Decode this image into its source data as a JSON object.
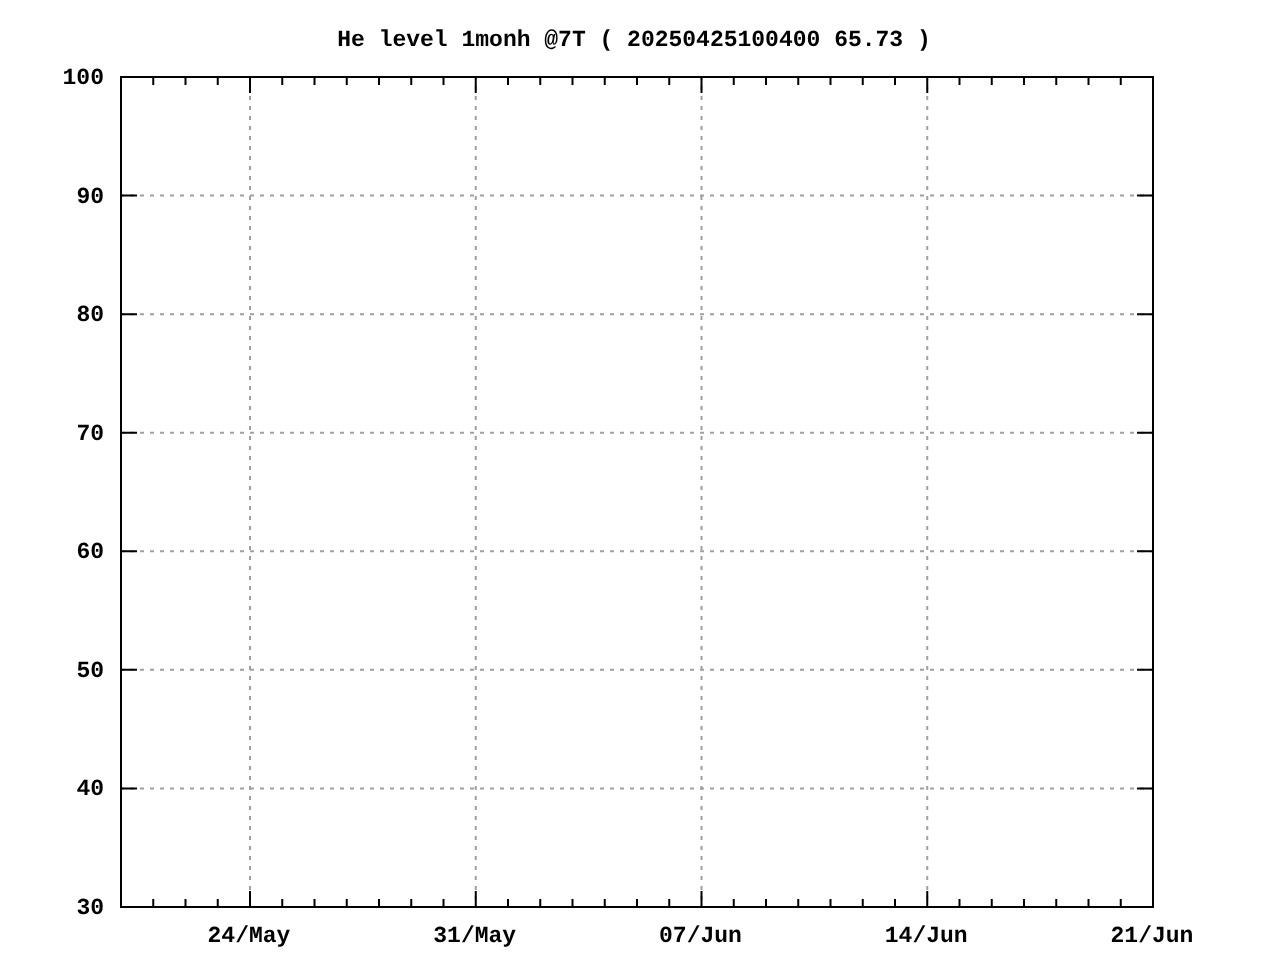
{
  "chart": {
    "chart_data": {
      "type": "line",
      "title": "He level 1monh @7T ( 20250425100400 65.73 )",
      "categories": [
        null,
        null,
        null,
        null,
        "24/May",
        null,
        null,
        null,
        null,
        null,
        null,
        "31/May",
        null,
        null,
        null,
        null,
        null,
        null,
        "07/Jun",
        null,
        null,
        null,
        null,
        null,
        null,
        "14/Jun",
        null,
        null,
        null,
        null,
        null,
        null,
        "21/Jun"
      ],
      "ylim": [
        30,
        100
      ],
      "grid": true,
      "yticks": [
        30,
        40,
        50,
        60,
        70,
        80,
        90,
        100
      ]
    }
  }
}
